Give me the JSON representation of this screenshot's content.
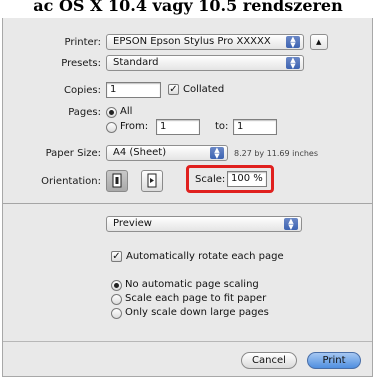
{
  "heading": "ac OS X 10.4 vagy 10.5 rendszeren",
  "printer": {
    "label": "Printer:",
    "value": "EPSON Epson Stylus Pro XXXXX"
  },
  "presets": {
    "label": "Presets:",
    "value": "Standard"
  },
  "copies": {
    "label": "Copies:",
    "value": "1",
    "collated_label": "Collated",
    "collated_checked": true
  },
  "pages": {
    "label": "Pages:",
    "all_label": "All",
    "from_label": "From:",
    "from_value": "1",
    "to_label": "to:",
    "to_value": "1"
  },
  "paper_size": {
    "label": "Paper Size:",
    "value": "A4 (Sheet)",
    "dimensions": "8.27 by 11.69 inches"
  },
  "orientation": {
    "label": "Orientation:"
  },
  "scale": {
    "label": "Scale:",
    "value": "100 %",
    "highlight_color": "#e0201e"
  },
  "section_popup": {
    "value": "Preview"
  },
  "auto_rotate": {
    "label": "Automatically rotate each page",
    "checked": true
  },
  "scaling_options": [
    {
      "label": "No automatic page scaling",
      "selected": true
    },
    {
      "label": "Scale each page to fit paper",
      "selected": false
    },
    {
      "label": "Only scale down large pages",
      "selected": false
    }
  ],
  "buttons": {
    "cancel": "Cancel",
    "print": "Print"
  }
}
